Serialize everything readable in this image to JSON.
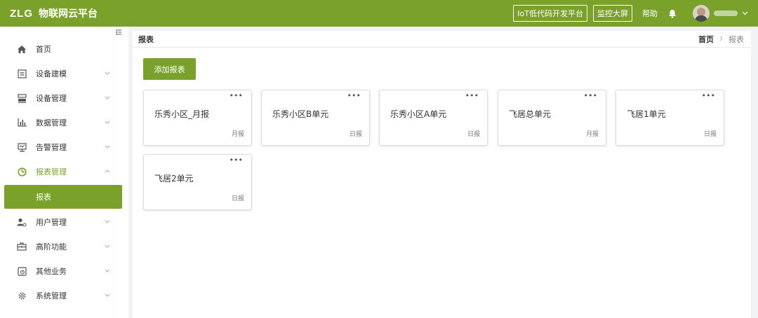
{
  "header": {
    "logo": "ZLG",
    "title": "物联网云平台",
    "iot_button": "IoT低代码开发平台",
    "monitor_button": "监控大屏",
    "help_label": "帮助",
    "colors": {
      "brand": "#7aa22a"
    }
  },
  "sidebar": {
    "items": [
      {
        "label": "首页",
        "icon": "home-icon"
      },
      {
        "label": "设备建模",
        "icon": "device-model-icon"
      },
      {
        "label": "设备管理",
        "icon": "device-manage-icon"
      },
      {
        "label": "数据管理",
        "icon": "bar-chart-icon"
      },
      {
        "label": "告警管理",
        "icon": "monitor-alert-icon"
      },
      {
        "label": "报表管理",
        "icon": "pie-clock-icon"
      },
      {
        "label": "用户管理",
        "icon": "user-icon"
      },
      {
        "label": "高阶功能",
        "icon": "toolbox-icon"
      },
      {
        "label": "其他业务",
        "icon": "other-icon"
      },
      {
        "label": "系统管理",
        "icon": "gear-icon"
      }
    ],
    "sub_item": "报表"
  },
  "main": {
    "page_title": "报表",
    "breadcrumb": {
      "home": "首页",
      "current": "报表"
    },
    "add_button": "添加报表",
    "more_glyph": "•••",
    "cards": [
      {
        "name": "乐秀小区_月报",
        "type": "月报"
      },
      {
        "name": "乐秀小区B单元",
        "type": "日报"
      },
      {
        "name": "乐秀小区A单元",
        "type": "日报"
      },
      {
        "name": "飞居总单元",
        "type": "月报"
      },
      {
        "name": "飞居1单元",
        "type": "日报"
      },
      {
        "name": "飞居2单元",
        "type": "日报"
      }
    ]
  }
}
